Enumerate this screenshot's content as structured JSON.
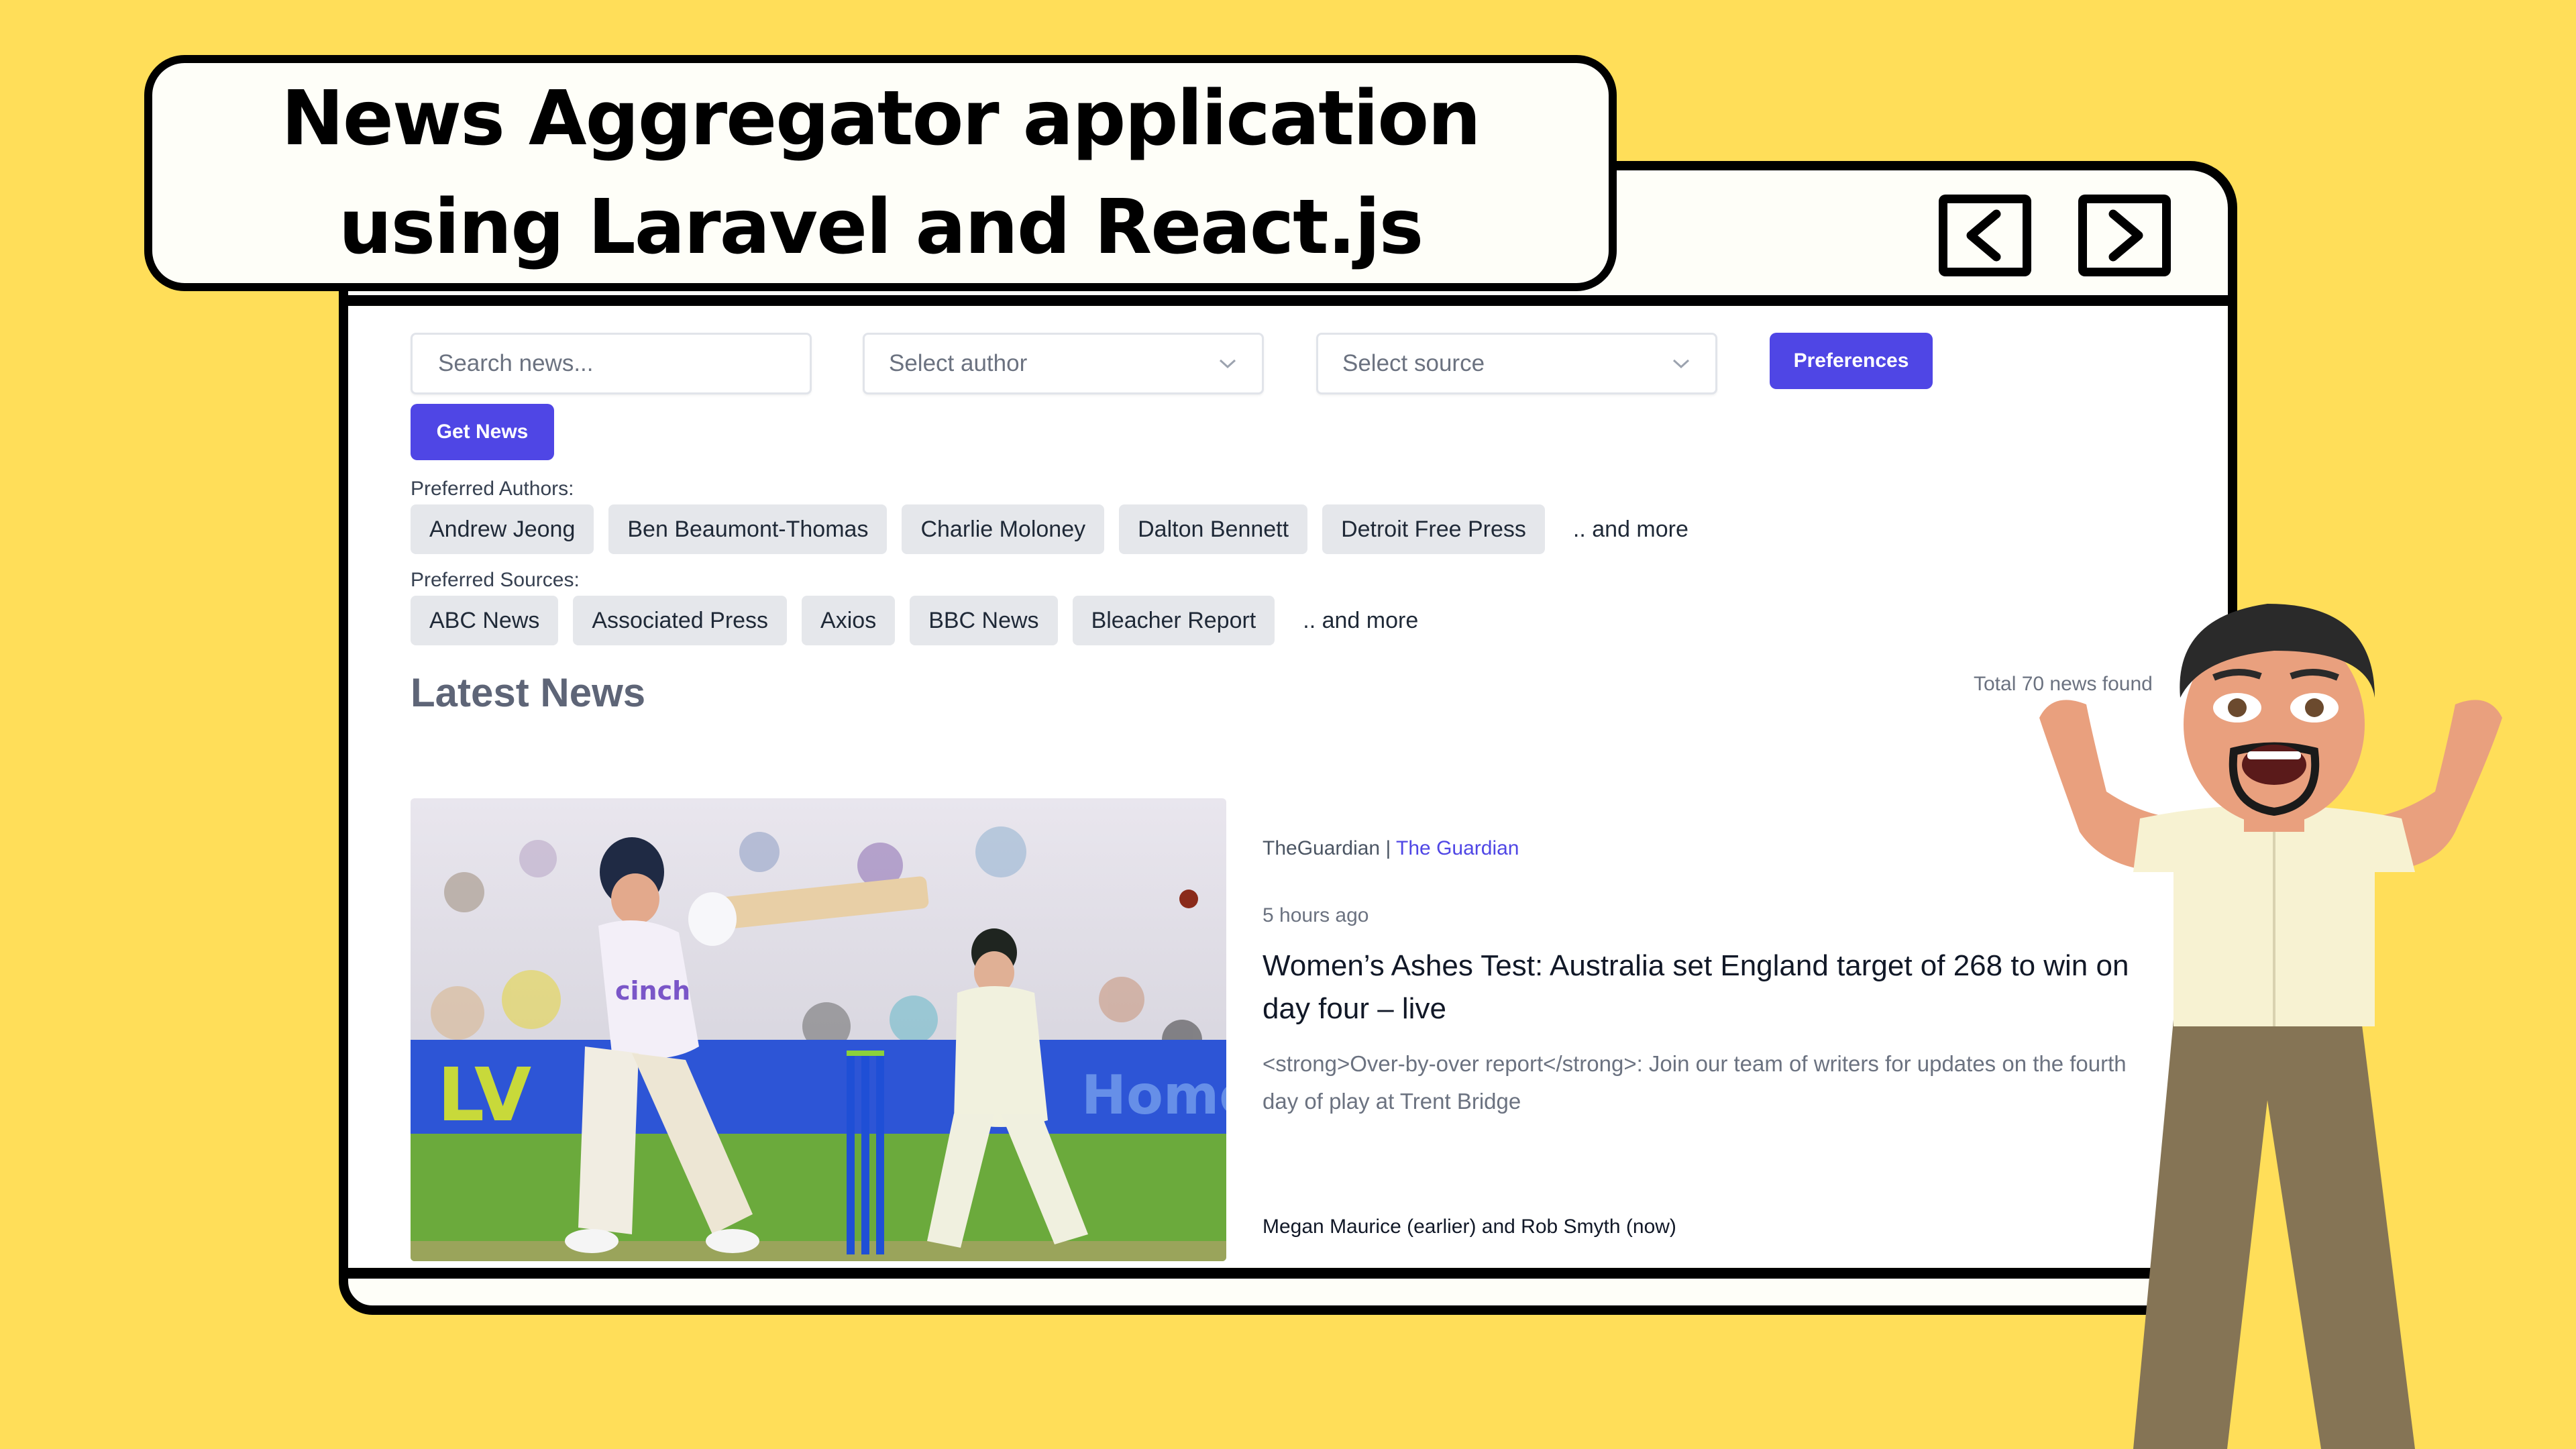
{
  "banner": {
    "title_line1": "News Aggregator application",
    "title_line2": "using Laravel and React.js"
  },
  "navigation": {
    "prev_icon": "chevron-left-icon",
    "next_icon": "chevron-right-icon"
  },
  "filters": {
    "search_placeholder": "Search news...",
    "search_value": "",
    "author_placeholder": "Select author",
    "source_placeholder": "Select source",
    "preferences_label": "Preferences",
    "get_news_label": "Get News"
  },
  "preferences": {
    "authors_label": "Preferred Authors:",
    "authors": [
      "Andrew Jeong",
      "Ben Beaumont-Thomas",
      "Charlie Moloney",
      "Dalton Bennett",
      "Detroit Free Press"
    ],
    "authors_more": ".. and more",
    "sources_label": "Preferred Sources:",
    "sources": [
      "ABC News",
      "Associated Press",
      "Axios",
      "BBC News",
      "Bleacher Report"
    ],
    "sources_more": ".. and more"
  },
  "news": {
    "heading": "Latest News",
    "total_text": "Total 70 news found",
    "articles": [
      {
        "api": "TheGuardian",
        "separator": "|",
        "source": "The Guardian",
        "time": "5 hours ago",
        "title": "Women’s Ashes Test: Australia set England target of 268 to win on day four – live",
        "description": "<strong>Over-by-over report</strong>: Join our team of writers for updates on the fourth day of play at Trent Bridge",
        "author": "Megan Maurice (earlier) and Rob Smyth (now)",
        "image_alt": "England batter playing a pull shot with Australian fielder behind at Trent Bridge"
      }
    ]
  },
  "colors": {
    "background": "#FFDE59",
    "accent": "#4F46E5",
    "chip": "#E5E7EB",
    "heading": "#5E6577"
  }
}
